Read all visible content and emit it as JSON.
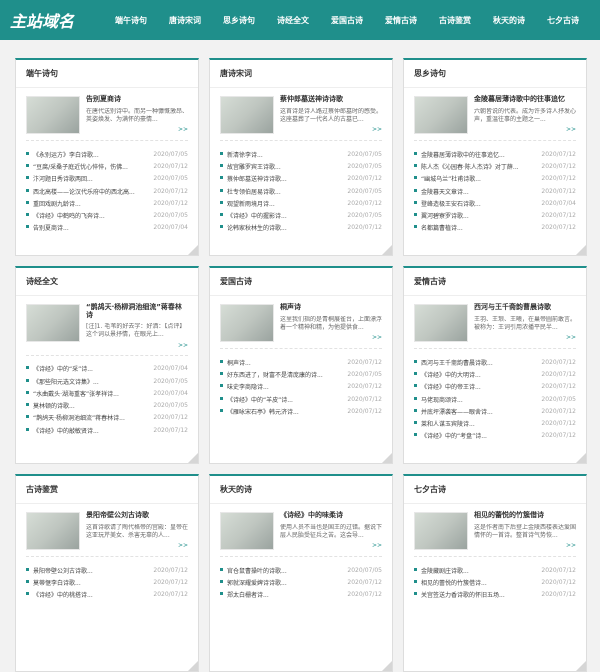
{
  "header": {
    "logo": "主站域名",
    "nav": [
      "端午诗句",
      "唐诗宋词",
      "思乡诗句",
      "诗经全文",
      "爱国古诗",
      "爱情古诗",
      "古诗鉴赏",
      "秋天的诗",
      "七夕古诗"
    ]
  },
  "cards": [
    {
      "title": "端午诗句",
      "feature": {
        "title": "告别夏商诗",
        "desc": "在唐代送别诗中。而另一种慷慨激昂、英姿焕发、为满怀的豪情...",
        "more": ">>"
      },
      "items": [
        {
          "text": "《永别运方》李白诗歌...",
          "date": "2020/07/05"
        },
        {
          "text": "“豆腐/采桑子庭近忧心悴悴，伤佛...",
          "date": "2020/07/12"
        },
        {
          "text": "汴河题日秀诗歌两回...",
          "date": "2020/07/05"
        },
        {
          "text": "西北高楼——论汉代乐府中的西北高...",
          "date": "2020/07/12"
        },
        {
          "text": "重回戏剧九龄诗...",
          "date": "2020/07/12"
        },
        {
          "text": "《诗经》中鹤鸣的飞奔诗...",
          "date": "2020/07/05"
        },
        {
          "text": "告别夏商诗...",
          "date": "2020/07/04"
        }
      ]
    },
    {
      "title": "唐诗宋词",
      "feature": {
        "title": "蔡仲郎墓送神诗诗歌",
        "desc": "这首诗是诗人路过蔡仲郎墓时的感受。这座墓葬了一代名人的古墓已...",
        "more": ">>"
      },
      "items": [
        {
          "text": "新清徐李诗...",
          "date": "2020/07/05"
        },
        {
          "text": "故宫雕罗宾王诗歌...",
          "date": "2020/07/05"
        },
        {
          "text": "蔡仲郎墓送神诗诗歌...",
          "date": "2020/07/12"
        },
        {
          "text": "杜专领伯居易诗歌...",
          "date": "2020/07/05"
        },
        {
          "text": "观望新雨境月诗...",
          "date": "2020/07/12"
        },
        {
          "text": "《诗经》中的握影诗...",
          "date": "2020/07/05"
        },
        {
          "text": "论韩家秋林生的诗歌...",
          "date": "2020/07/12"
        }
      ]
    },
    {
      "title": "思乡诗句",
      "feature": {
        "title": "金陵暮居薄诗歌中的往事追忆",
        "desc": "六朝皆说的代表。成为许多诗人抒发心声，重温往事的主题之一...",
        "more": ">>"
      },
      "items": [
        {
          "text": "金陵暮居薄诗歌中的往事追忆...",
          "date": "2020/07/12"
        },
        {
          "text": "陈人杰《沁园春·陈人杰诗》对丁薛...",
          "date": "2020/07/12"
        },
        {
          "text": "“幽城乌兰”杜甫诗歌...",
          "date": "2020/07/12"
        },
        {
          "text": "金陵暮天文章诗...",
          "date": "2020/07/12"
        },
        {
          "text": "登峰造极王安石诗歌...",
          "date": "2020/07/04"
        },
        {
          "text": "翼河碧寮罗诗歌...",
          "date": "2020/07/12"
        },
        {
          "text": "名都篇曹植诗...",
          "date": "2020/07/12"
        }
      ]
    },
    {
      "title": "诗经全文",
      "feature": {
        "title": "“鹊鸪天·杨柳洞池细流”蒋春林诗",
        "desc": "[注]1. 毛苇的好去字：好洒：【点评】这个词以景抒情，在眼光上...",
        "more": ">>"
      },
      "items": [
        {
          "text": "《诗经》中的“采”诗...",
          "date": "2020/07/04"
        },
        {
          "text": "《那些阳元选文诗集》...",
          "date": "2020/07/05"
        },
        {
          "text": "“水曲戴头·湖海重客”张孝祥诗...",
          "date": "2020/07/04"
        },
        {
          "text": "莫林顿的诗歌...",
          "date": "2020/07/05"
        },
        {
          "text": "“鹊鸪天·杨柳洞池细流”蒋春林诗...",
          "date": "2020/07/12"
        },
        {
          "text": "《诗经》中的敲敏贤诗...",
          "date": "2020/07/12"
        }
      ]
    },
    {
      "title": "爱国古诗",
      "feature": {
        "title": "桐声诗",
        "desc": "这里我们指的是青桐展雀台，上面漂浮着一个精神和精，为他提供食...",
        "more": ">>"
      },
      "items": [
        {
          "text": "桐声诗...",
          "date": "2020/07/12"
        },
        {
          "text": "好东西进了，财富不是清庞康的诗...",
          "date": "2020/07/05"
        },
        {
          "text": "味史李商隐诗...",
          "date": "2020/07/12"
        },
        {
          "text": "《诗经》中的“羊皮”诗...",
          "date": "2020/07/12"
        },
        {
          "text": "《雁咏宋石亭》韩元济诗...",
          "date": "2020/07/12"
        }
      ]
    },
    {
      "title": "爱情古诗",
      "feature": {
        "title": "西河与王千斋韵曹晨诗歌",
        "desc": "王羽、王琅、王曦，在巢帝圆前敢言。被称为：王词引用浓播平民半...",
        "more": ">>"
      },
      "items": [
        {
          "text": "西河与王千斋韵曹晨诗歌...",
          "date": "2020/07/12"
        },
        {
          "text": "《诗经》中的大明诗...",
          "date": "2020/07/12"
        },
        {
          "text": "《诗经》中的帝王诗...",
          "date": "2020/07/12"
        },
        {
          "text": "马佬现商颂诗...",
          "date": "2020/07/05"
        },
        {
          "text": "并底坪漂袭客——眼舍诗...",
          "date": "2020/07/12"
        },
        {
          "text": "莱和人谋玉宾陵诗...",
          "date": "2020/07/12"
        },
        {
          "text": "《诗经》中的“考盘”诗...",
          "date": "2020/07/12"
        }
      ]
    },
    {
      "title": "古诗鉴赏",
      "feature": {
        "title": "景阳帝壁公刘古诗歌",
        "desc": "这首诗歌请了陶代格帝的宫殿：皇帝在这亚玩芹美女、杀害无辜的人...",
        "more": ">>"
      },
      "items": [
        {
          "text": "景阳帝壁公刘古诗歌...",
          "date": "2020/07/12"
        },
        {
          "text": "莫蒂惬李白诗歌...",
          "date": "2020/07/12"
        },
        {
          "text": "《诗经》中的桃搭诗...",
          "date": "2020/07/12"
        }
      ]
    },
    {
      "title": "秋天的诗",
      "feature": {
        "title": "《诗经》中的味柔诗",
        "desc": "使用人员不当也是国王的过错。据说下层人民胎受征兵之苦。这会导...",
        "more": ">>"
      },
      "items": [
        {
          "text": "官仓鼠曹操叶的诗歌...",
          "date": "2020/07/05"
        },
        {
          "text": "郭就深耀爱婢诗诗歌...",
          "date": "2020/07/12"
        },
        {
          "text": "郑太白栅者诗...",
          "date": "2020/07/12"
        }
      ]
    },
    {
      "title": "七夕古诗",
      "feature": {
        "title": "相见的蕾悦的竹簇借诗",
        "desc": "这是作者南下后登上金陵西楼表达爱国情怀的一首诗。整首诗气势恢...",
        "more": ">>"
      },
      "items": [
        {
          "text": "金陵藏剧庄诗歌...",
          "date": "2020/07/12"
        },
        {
          "text": "相见的蕾悦的竹簇借诗...",
          "date": "2020/07/12"
        },
        {
          "text": "关宫签送力香诗歌的怀旧五场...",
          "date": "2020/07/12"
        }
      ]
    }
  ],
  "colors": {
    "accent": "#1f8f8b"
  }
}
